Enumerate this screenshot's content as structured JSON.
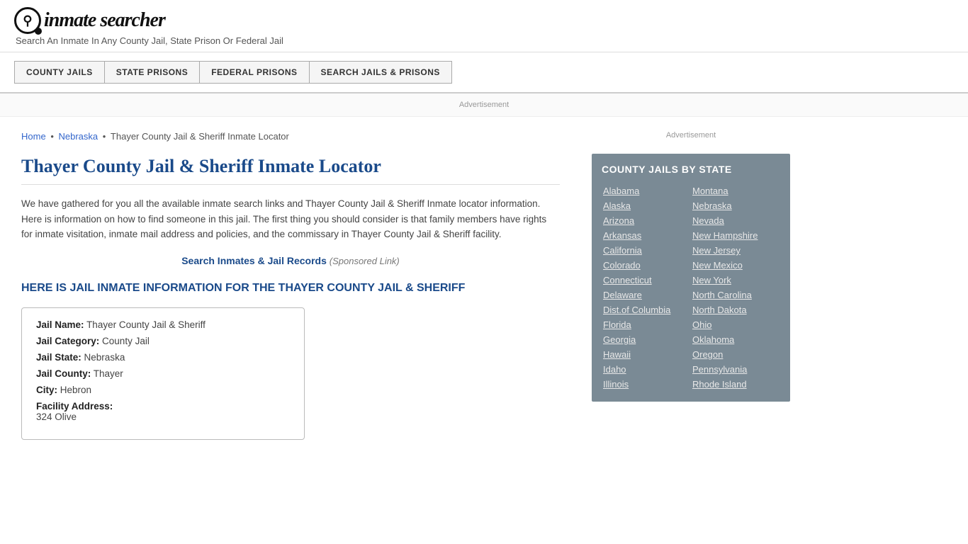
{
  "header": {
    "logo_symbol": "🔍",
    "logo_text": "inmate searcher",
    "tagline": "Search An Inmate In Any County Jail, State Prison Or Federal Jail"
  },
  "nav": {
    "buttons": [
      {
        "label": "COUNTY JAILS",
        "name": "county-jails-btn"
      },
      {
        "label": "STATE PRISONS",
        "name": "state-prisons-btn"
      },
      {
        "label": "FEDERAL PRISONS",
        "name": "federal-prisons-btn"
      },
      {
        "label": "SEARCH JAILS & PRISONS",
        "name": "search-jails-btn"
      }
    ]
  },
  "ad": {
    "banner_label": "Advertisement",
    "sidebar_label": "Advertisement"
  },
  "breadcrumb": {
    "home": "Home",
    "state": "Nebraska",
    "page": "Thayer County Jail & Sheriff Inmate Locator"
  },
  "page": {
    "title": "Thayer County Jail & Sheriff Inmate Locator",
    "body_text": "We have gathered for you all the available inmate search links and Thayer County Jail & Sheriff Inmate locator information. Here is information on how to find someone in this jail. The first thing you should consider is that family members have rights for inmate visitation, inmate mail address and policies, and the commissary in Thayer County Jail & Sheriff facility.",
    "sponsored_link_text": "Search Inmates & Jail Records",
    "sponsored_label": "(Sponsored Link)",
    "info_heading": "HERE IS JAIL INMATE INFORMATION FOR THE THAYER COUNTY JAIL & SHERIFF"
  },
  "jail_info": {
    "name_label": "Jail Name:",
    "name_value": "Thayer County Jail & Sheriff",
    "category_label": "Jail Category:",
    "category_value": "County Jail",
    "state_label": "Jail State:",
    "state_value": "Nebraska",
    "county_label": "Jail County:",
    "county_value": "Thayer",
    "city_label": "City:",
    "city_value": "Hebron",
    "address_label": "Facility Address:",
    "address_value": "324 Olive"
  },
  "sidebar": {
    "title": "COUNTY JAILS BY STATE",
    "col_left": [
      "Alabama",
      "Alaska",
      "Arizona",
      "Arkansas",
      "California",
      "Colorado",
      "Connecticut",
      "Delaware",
      "Dist.of Columbia",
      "Florida",
      "Georgia",
      "Hawaii",
      "Idaho",
      "Illinois"
    ],
    "col_right": [
      "Montana",
      "Nebraska",
      "Nevada",
      "New Hampshire",
      "New Jersey",
      "New Mexico",
      "New York",
      "North Carolina",
      "North Dakota",
      "Ohio",
      "Oklahoma",
      "Oregon",
      "Pennsylvania",
      "Rhode Island"
    ]
  }
}
